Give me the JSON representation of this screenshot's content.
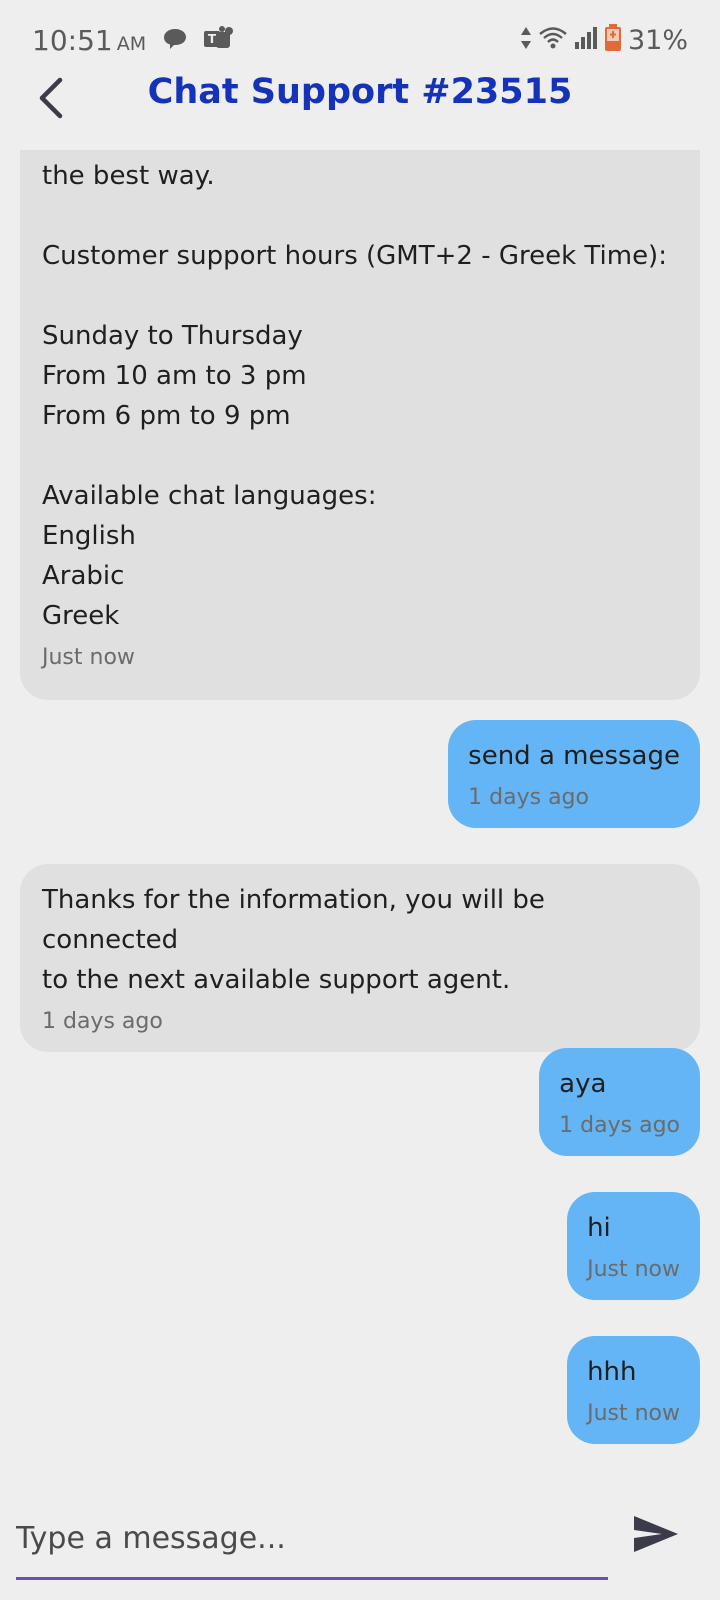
{
  "status_bar": {
    "time": "10:51",
    "ampm": "AM",
    "battery": "31%",
    "left_icons": [
      "chat-bubble-icon",
      "teams-icon"
    ],
    "right_icons": [
      "data-arrows-icon",
      "wifi-icon",
      "signal-icon",
      "battery-icon"
    ]
  },
  "header": {
    "title": "Chat Support #23515",
    "title_color": "#1533b8"
  },
  "messages": [
    {
      "direction": "incoming",
      "lines": [
        "the best way.",
        "",
        "Customer support hours (GMT+2 - Greek Time):",
        "",
        "Sunday to Thursday",
        "From 10 am to 3 pm",
        "From 6 pm to 9 pm",
        "",
        "Available chat languages:",
        "English",
        "Arabic",
        "Greek"
      ],
      "time": "Just now"
    },
    {
      "direction": "outgoing",
      "text": "send a message",
      "time": "1 days ago"
    },
    {
      "direction": "incoming",
      "lines": [
        "Thanks for the information, you will be connected",
        "to the next available support agent."
      ],
      "time": "1 days ago"
    },
    {
      "direction": "outgoing",
      "text": "aya",
      "time": "1 days ago"
    },
    {
      "direction": "outgoing",
      "text": "hi",
      "time": "Just now"
    },
    {
      "direction": "outgoing",
      "text": "hhh",
      "time": "Just now"
    }
  ],
  "composer": {
    "placeholder": "Type a message...",
    "value": ""
  },
  "colors": {
    "incoming_bubble": "#e0e0e0",
    "outgoing_bubble": "#64b5f6",
    "background": "#eeeeee",
    "input_underline": "#6a4fb0"
  }
}
